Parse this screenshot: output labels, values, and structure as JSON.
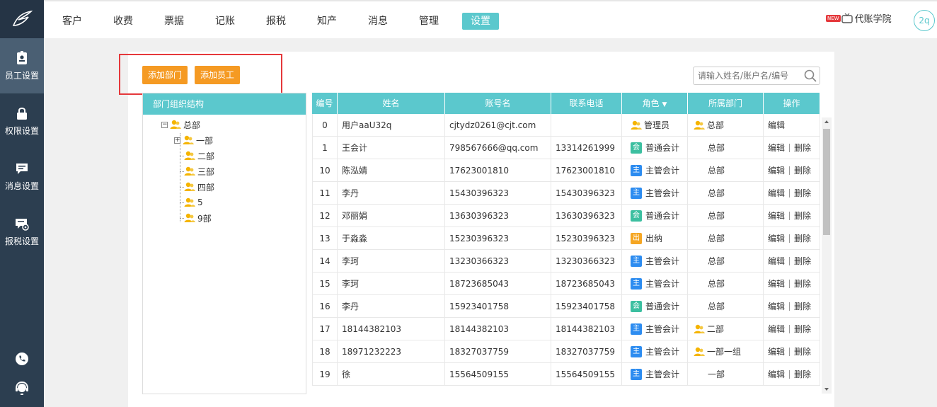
{
  "nav": {
    "items": [
      "客户",
      "收费",
      "票据",
      "记账",
      "报税",
      "知产",
      "消息",
      "管理",
      "设置"
    ],
    "active_index": 8,
    "academy_badge": "NEW",
    "academy_label": "代账学院",
    "avatar_text": "2q"
  },
  "sidebar": {
    "items": [
      {
        "label": "员工设置",
        "icon": "id-badge-icon"
      },
      {
        "label": "权限设置",
        "icon": "lock-icon"
      },
      {
        "label": "消息设置",
        "icon": "message-icon"
      },
      {
        "label": "报税设置",
        "icon": "tax-settings-icon"
      }
    ],
    "active_index": 0,
    "bottom_icons": [
      "phone-icon",
      "support-headset-icon"
    ]
  },
  "toolbar": {
    "add_dept_label": "添加部门",
    "add_staff_label": "添加员工",
    "search_placeholder": "请输入姓名/账户名/编号"
  },
  "tree": {
    "title": "部门组织结构",
    "root": "总部",
    "children": [
      "一部",
      "二部",
      "三部",
      "四部",
      "5",
      "9部"
    ]
  },
  "table": {
    "headers": [
      "编号",
      "姓名",
      "账号名",
      "联系电话",
      "角色",
      "所属部门",
      "操作"
    ],
    "edit_label": "编辑",
    "delete_label": "删除",
    "rows": [
      {
        "id": "0",
        "name": "用户aaU32q",
        "account": "cjtydz0261@cjt.com",
        "phone": "",
        "role_tag": "",
        "role": "管理员",
        "role_type": "admin",
        "dept": "总部",
        "dept_icon": true,
        "deletable": false
      },
      {
        "id": "1",
        "name": "王会计",
        "account": "798567666@qq.com",
        "phone": "13314261999",
        "role_tag": "会",
        "role": "普通会计",
        "role_type": "accountant",
        "dept": "总部",
        "dept_icon": false,
        "deletable": true
      },
      {
        "id": "10",
        "name": "陈泓婧",
        "account": "17623001810",
        "phone": "17623001810",
        "role_tag": "主",
        "role": "主管会计",
        "role_type": "supervisor",
        "dept": "总部",
        "dept_icon": false,
        "deletable": true
      },
      {
        "id": "11",
        "name": "李丹",
        "account": "15430396323",
        "phone": "15430396323",
        "role_tag": "主",
        "role": "主管会计",
        "role_type": "supervisor",
        "dept": "总部",
        "dept_icon": false,
        "deletable": true
      },
      {
        "id": "12",
        "name": "邓丽娟",
        "account": "13630396323",
        "phone": "13630396323",
        "role_tag": "会",
        "role": "普通会计",
        "role_type": "accountant",
        "dept": "总部",
        "dept_icon": false,
        "deletable": true
      },
      {
        "id": "13",
        "name": "于淼淼",
        "account": "15230396323",
        "phone": "15230396323",
        "role_tag": "出",
        "role": "出纳",
        "role_type": "cashier",
        "dept": "总部",
        "dept_icon": false,
        "deletable": true
      },
      {
        "id": "14",
        "name": "李珂",
        "account": "13230366323",
        "phone": "13230366323",
        "role_tag": "主",
        "role": "主管会计",
        "role_type": "supervisor",
        "dept": "总部",
        "dept_icon": false,
        "deletable": true
      },
      {
        "id": "15",
        "name": "李珂",
        "account": "18723685043",
        "phone": "18723685043",
        "role_tag": "主",
        "role": "主管会计",
        "role_type": "supervisor",
        "dept": "总部",
        "dept_icon": false,
        "deletable": true
      },
      {
        "id": "16",
        "name": "李丹",
        "account": "15923401758",
        "phone": "15923401758",
        "role_tag": "会",
        "role": "普通会计",
        "role_type": "accountant",
        "dept": "总部",
        "dept_icon": false,
        "deletable": true
      },
      {
        "id": "17",
        "name": "18144382103",
        "account": "18144382103",
        "phone": "18144382103",
        "role_tag": "主",
        "role": "主管会计",
        "role_type": "supervisor",
        "dept": "二部",
        "dept_icon": true,
        "deletable": true
      },
      {
        "id": "18",
        "name": "18971232223",
        "account": "18327037759",
        "phone": "18327037759",
        "role_tag": "主",
        "role": "主管会计",
        "role_type": "supervisor",
        "dept": "一部一组",
        "dept_icon": true,
        "deletable": true
      },
      {
        "id": "19",
        "name": "徐",
        "account": "15564509155",
        "phone": "15564509155",
        "role_tag": "主",
        "role": "主管会计",
        "role_type": "supervisor",
        "dept": "一部",
        "dept_icon": false,
        "deletable": true
      }
    ]
  },
  "colors": {
    "accent": "#5bc8cd",
    "orange": "#f59a23",
    "sidebar": "#2c3e50",
    "highlight_box": "#e5383b",
    "user_icon": "#f5b400",
    "tag_accountant": "#3cbfa0",
    "tag_supervisor": "#2d8cf0",
    "tag_cashier": "#f5a623"
  }
}
